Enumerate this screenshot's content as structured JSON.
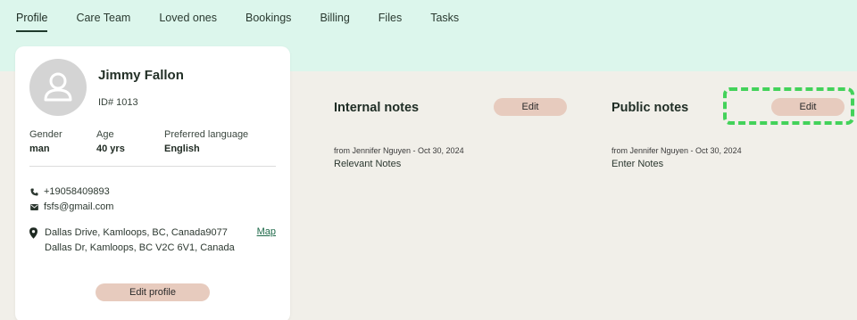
{
  "tabs": [
    {
      "label": "Profile",
      "active": true
    },
    {
      "label": "Care Team",
      "active": false
    },
    {
      "label": "Loved ones",
      "active": false
    },
    {
      "label": "Bookings",
      "active": false
    },
    {
      "label": "Billing",
      "active": false
    },
    {
      "label": "Files",
      "active": false
    },
    {
      "label": "Tasks",
      "active": false
    }
  ],
  "profile": {
    "name": "Jimmy Fallon",
    "id": "ID# 1013",
    "gender_label": "Gender",
    "gender": "man",
    "age_label": "Age",
    "age": "40 yrs",
    "language_label": "Preferred language",
    "language": "English",
    "phone": "+19058409893",
    "email": "fsfs@gmail.com",
    "address_line1": "Dallas Drive, Kamloops, BC, Canada9077",
    "address_line2": "Dallas Dr, Kamloops, BC V2C 6V1, Canada",
    "map_label": "Map",
    "edit_label": "Edit profile"
  },
  "internal_notes": {
    "title": "Internal notes",
    "edit_label": "Edit",
    "meta": "from Jennifer Nguyen - Oct 30, 2024",
    "body": "Relevant Notes"
  },
  "public_notes": {
    "title": "Public notes",
    "edit_label": "Edit",
    "meta": "from Jennifer Nguyen - Oct 30, 2024",
    "body": "Enter Notes"
  },
  "colors": {
    "header_band": "#dcf6ec",
    "page_bg": "#f1efe9",
    "button_bg": "#e7cbbe",
    "highlight": "#43d25a"
  },
  "icons": [
    "avatar-icon",
    "phone-icon",
    "email-icon",
    "location-pin-icon"
  ]
}
